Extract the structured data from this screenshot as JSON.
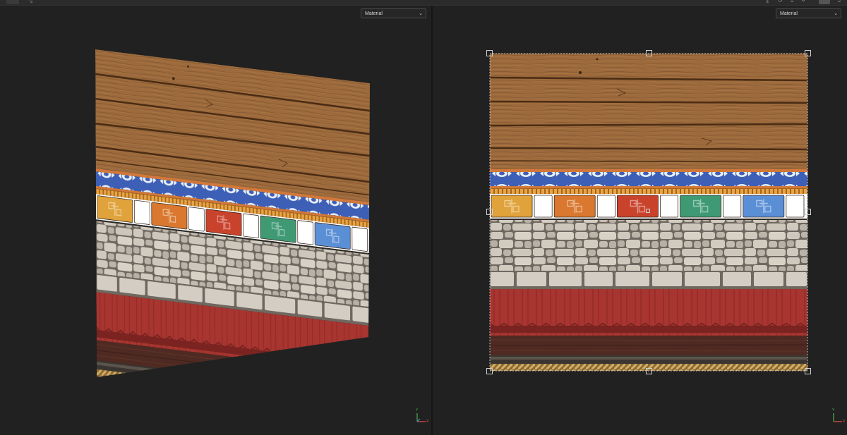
{
  "viewports": {
    "left": {
      "shading_dropdown": {
        "value": "Material"
      }
    },
    "right": {
      "shading_dropdown": {
        "value": "Material"
      }
    }
  },
  "gizmo": {
    "y_label": "Y",
    "x_label": "X"
  },
  "texture_rows": [
    "wood-planks",
    "blue-ornament-band",
    "colored-tiles",
    "stone-wall",
    "stone-ledge",
    "red-drapery",
    "dark-wood-base",
    "rope-trim"
  ],
  "tile_colors": [
    "#e0a23a",
    "#ffffff",
    "#d9782e",
    "#ffffff",
    "#c9432c",
    "#ffffff",
    "#3f9a74",
    "#ffffff",
    "#5a8fd6",
    "#ffffff"
  ],
  "colors": {
    "wood": "#9c6a3c",
    "wood_dark": "#6f4522",
    "blue_band": "#3d5fb6",
    "orange_trim": "#d9862f",
    "stone": "#bfb7ac",
    "ledge": "#d3cdc3",
    "red": "#a3312d",
    "base": "#4e2a22",
    "rope": "#b48a48"
  }
}
